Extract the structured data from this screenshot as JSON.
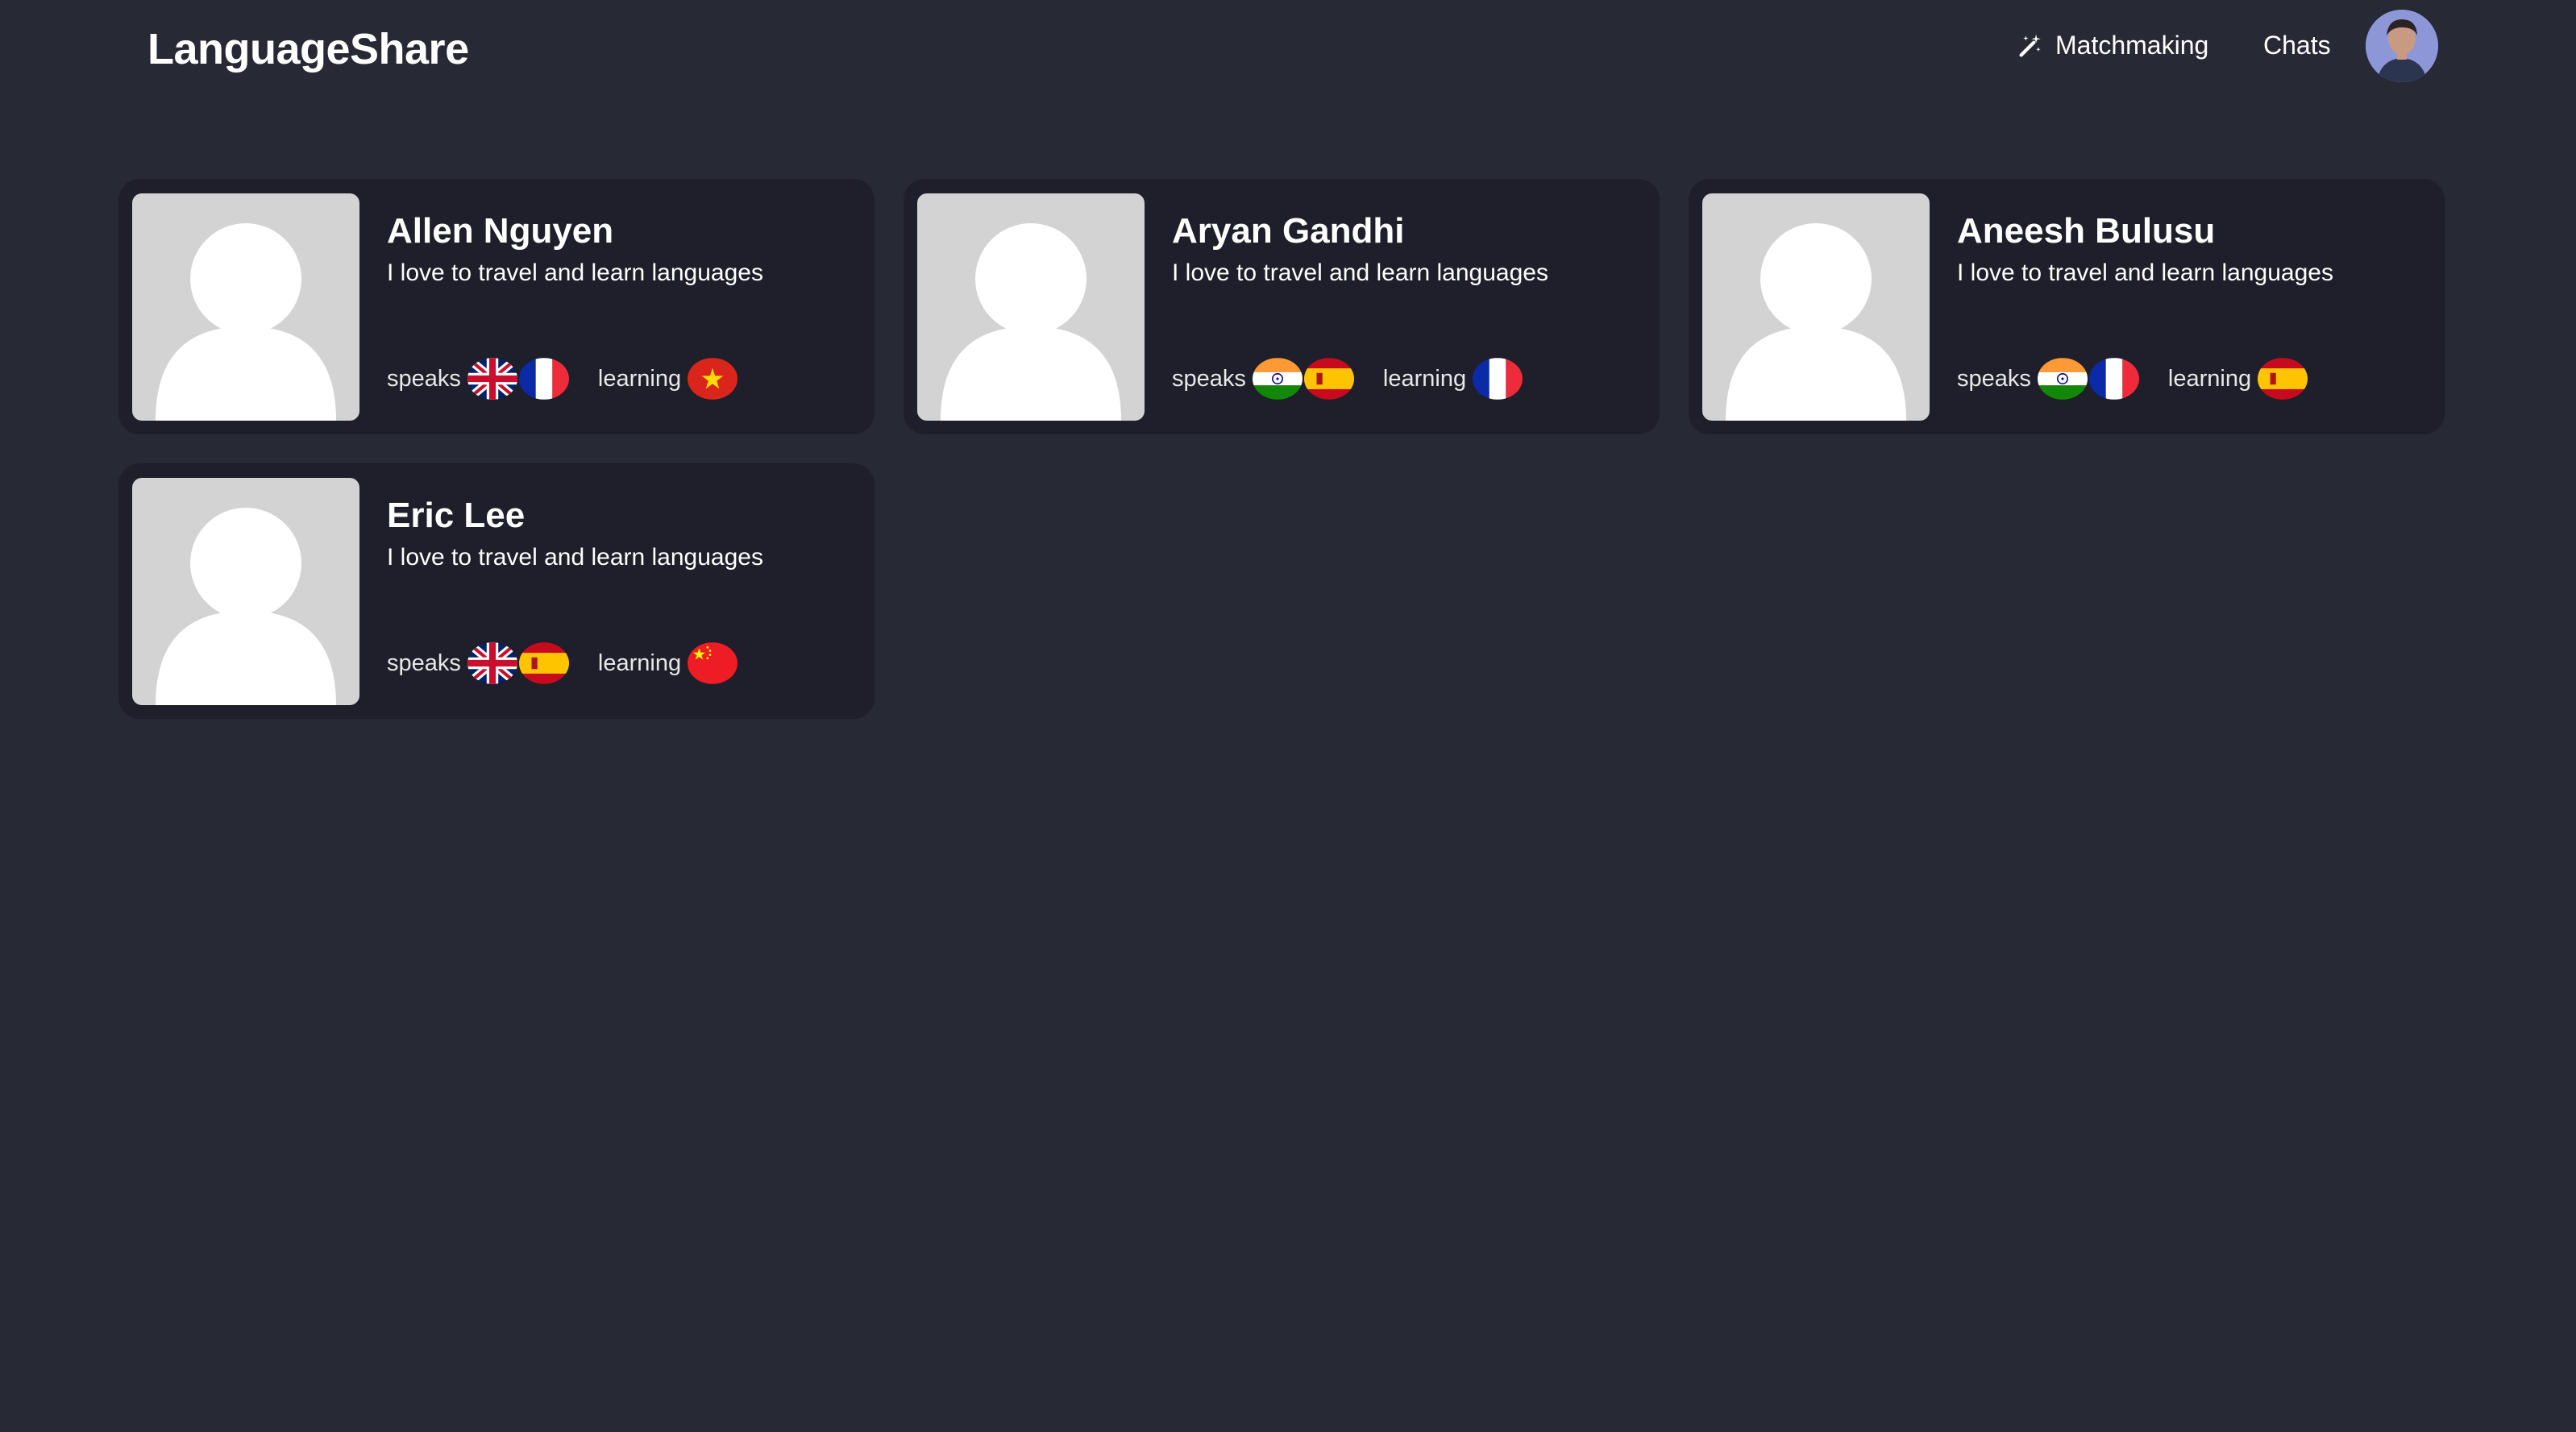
{
  "app": {
    "brand": "LanguageShare"
  },
  "nav": {
    "matchmaking_label": "Matchmaking",
    "matchmaking_icon": "magic-wand-icon",
    "chats_label": "Chats",
    "avatar_icon": "user-avatar"
  },
  "labels": {
    "speaks": "speaks",
    "learning": "learning"
  },
  "cards": [
    {
      "name": "Allen Nguyen",
      "bio": "I love to travel and learn languages",
      "speaks": [
        "uk",
        "france"
      ],
      "learning": [
        "vietnam"
      ]
    },
    {
      "name": "Aryan Gandhi",
      "bio": "I love to travel and learn languages",
      "speaks": [
        "india",
        "spain"
      ],
      "learning": [
        "france"
      ]
    },
    {
      "name": "Aneesh Bulusu",
      "bio": "I love to travel and learn languages",
      "speaks": [
        "india",
        "france"
      ],
      "learning": [
        "spain"
      ]
    },
    {
      "name": "Eric Lee",
      "bio": "I love to travel and learn languages",
      "speaks": [
        "uk",
        "spain"
      ],
      "learning": [
        "china"
      ]
    }
  ],
  "colors": {
    "background": "#272935",
    "card": "#1e1f2a",
    "photo_placeholder": "#d3d3d3",
    "text": "#ffffff"
  }
}
